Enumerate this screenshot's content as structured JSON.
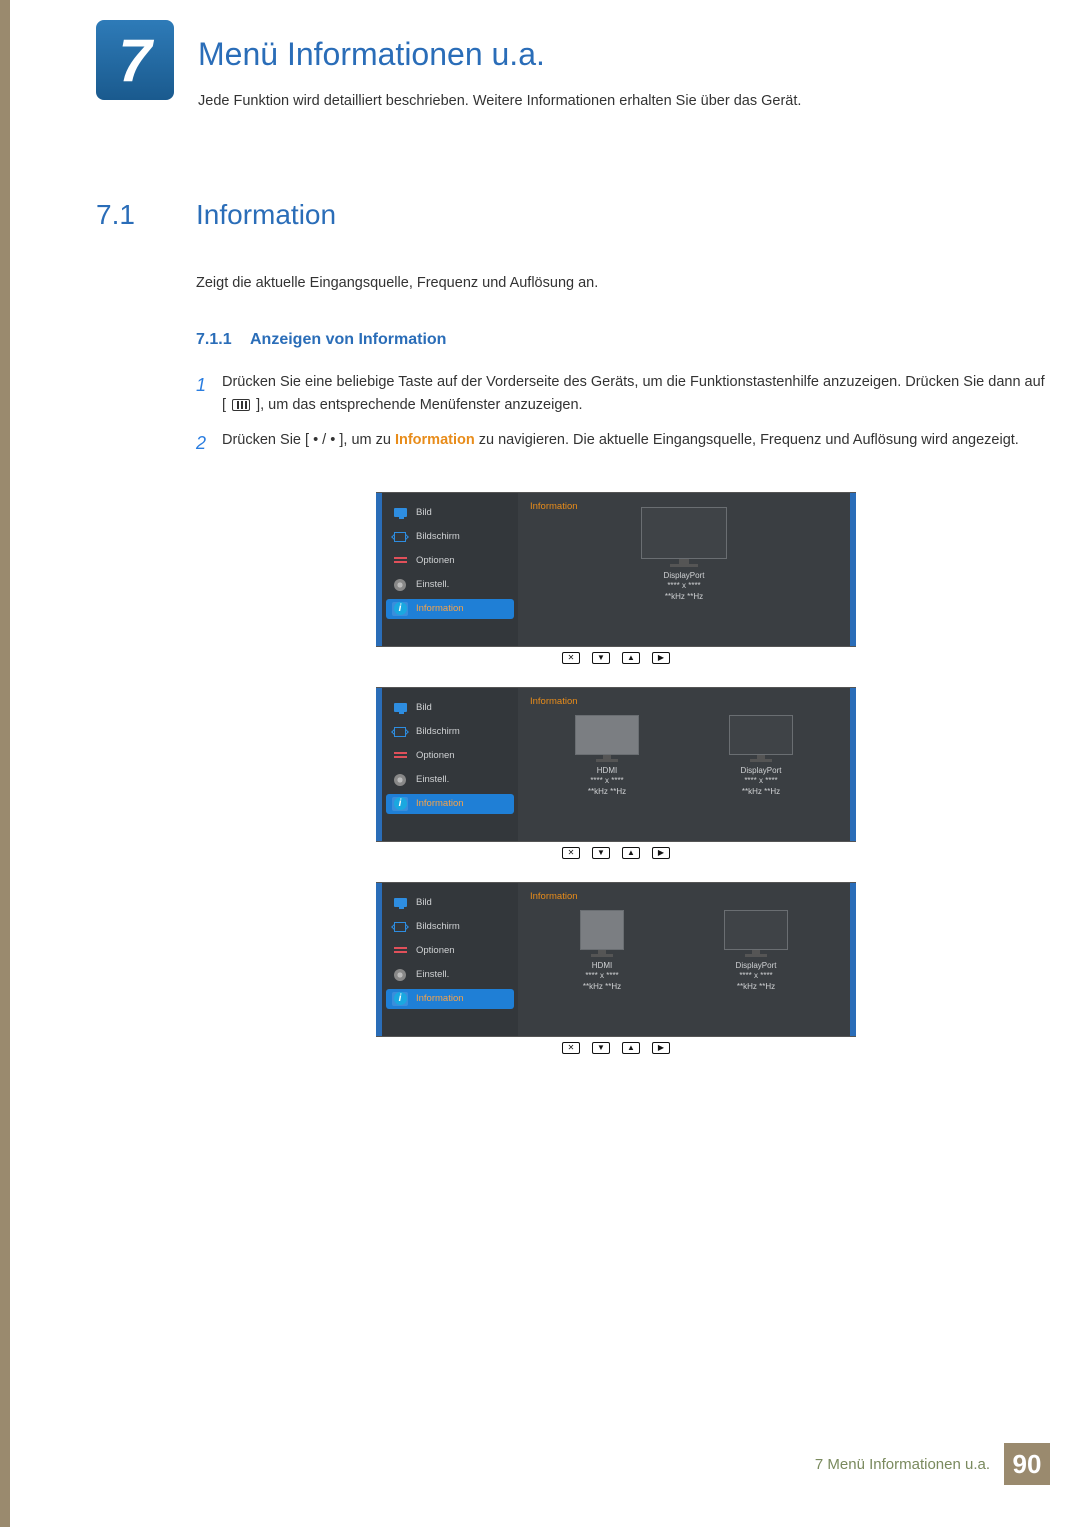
{
  "chapter": {
    "number": "7",
    "title": "Menü Informationen u.a.",
    "desc": "Jede Funktion wird detailliert beschrieben. Weitere Informationen erhalten Sie über das Gerät."
  },
  "section": {
    "num": "7.1",
    "title": "Information",
    "desc": "Zeigt die aktuelle Eingangsquelle, Frequenz und Auflösung an."
  },
  "subsection": {
    "num": "7.1.1",
    "title": "Anzeigen von Information"
  },
  "step1": {
    "num": "1",
    "p1": "Drücken Sie eine beliebige Taste auf der Vorderseite des Geräts, um die Funktionstastenhilfe anzuzeigen. Drücken Sie dann auf [",
    "p2": "], um das entsprechende Menüfenster anzuzeigen."
  },
  "step2": {
    "num": "2",
    "p1": "Drücken Sie [ ",
    "dot1": "•",
    "sep": " / ",
    "dot2": "•",
    "p2": " ], um zu ",
    "hl": "Information",
    "p3": " zu navigieren. Die aktuelle Eingangsquelle, Frequenz und Auflösung wird angezeigt."
  },
  "osd": {
    "panelTitle": "Information",
    "sidebar": [
      "Bild",
      "Bildschirm",
      "Optionen",
      "Einstell.",
      "Information"
    ],
    "labels": {
      "displayport": "DisplayPort",
      "hdmi": "HDMI",
      "res": "**** x ****",
      "freq": "**kHz **Hz"
    },
    "nav": [
      "✕",
      "▼",
      "▲",
      "▶"
    ],
    "infoIcon": "i"
  },
  "footer": {
    "text": "7 Menü Informationen u.a.",
    "page": "90"
  }
}
